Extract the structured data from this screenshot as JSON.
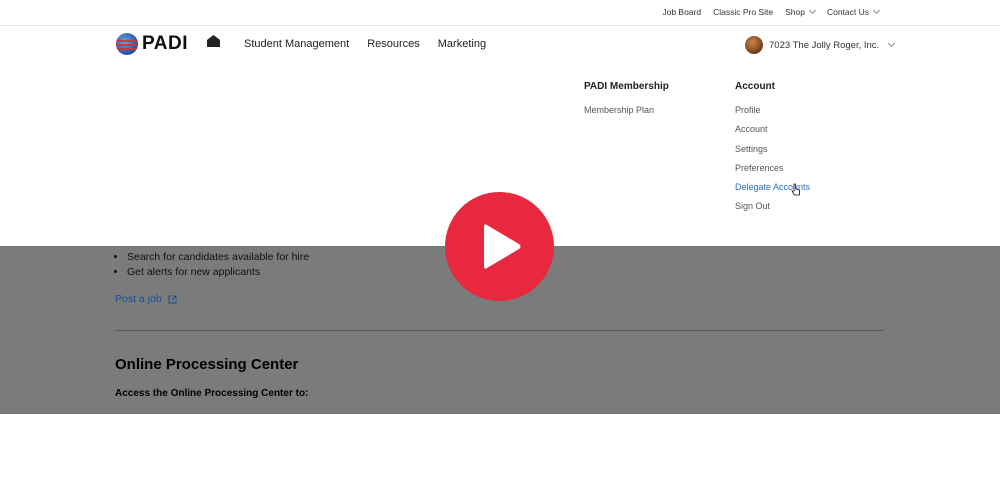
{
  "utility_bar": {
    "links": [
      {
        "label": "Job Board",
        "dropdown": false
      },
      {
        "label": "Classic Pro Site",
        "dropdown": false
      },
      {
        "label": "Shop",
        "dropdown": true
      },
      {
        "label": "Contact Us",
        "dropdown": true
      }
    ]
  },
  "brand": {
    "logo_text": "PADI"
  },
  "nav": {
    "home_icon": "home-icon",
    "items": [
      "Student Management",
      "Resources",
      "Marketing"
    ]
  },
  "account": {
    "name": "7023 The Jolly Roger, Inc."
  },
  "dropdown": {
    "membership": {
      "heading": "PADI Membership",
      "items": [
        "Membership Plan"
      ]
    },
    "account": {
      "heading": "Account",
      "items": [
        "Profile",
        "Account",
        "Settings",
        "Preferences",
        "Delegate Accounts",
        "Sign Out"
      ],
      "active_index": 4
    }
  },
  "page": {
    "bullets": [
      "Search for candidates available for hire",
      "Get alerts for new applicants"
    ],
    "post_job": "Post a job",
    "section_title": "Online Processing Center",
    "section_sub": "Access the Online Processing Center to:"
  },
  "colors": {
    "play": "#e8283e",
    "link": "#2a6fb8",
    "overlay": "#7b7b7b"
  }
}
